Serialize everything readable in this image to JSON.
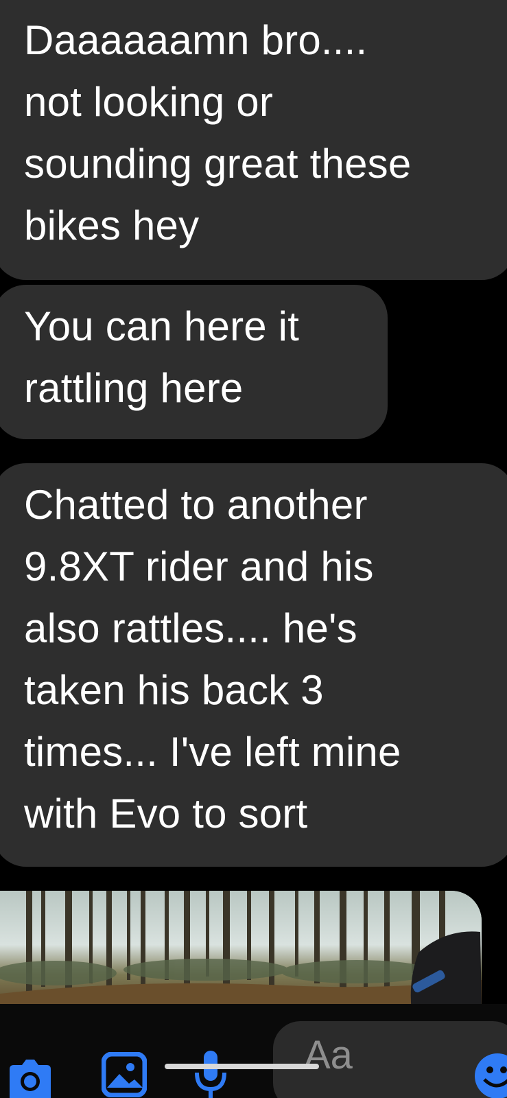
{
  "conversation": {
    "messages": [
      {
        "text": "Daaaaaamn bro....\nnot looking or\nsounding great these\nbikes hey"
      },
      {
        "text": "You can here it\nrattling here"
      },
      {
        "text": "Chatted to another\n9.8XT rider and his\nalso rattles.... he's\ntaken his back 3\ntimes... I've left mine\nwith Evo to sort"
      }
    ]
  },
  "composer": {
    "placeholder": "Aa",
    "icons": [
      "camera-icon",
      "gallery-icon",
      "microphone-icon",
      "emoji-icon"
    ],
    "accent_color": "#2f7bf5"
  },
  "colors": {
    "background": "#000000",
    "bubble": "#2e2e2e",
    "text": "#ffffff",
    "accent": "#2f7bf5"
  }
}
